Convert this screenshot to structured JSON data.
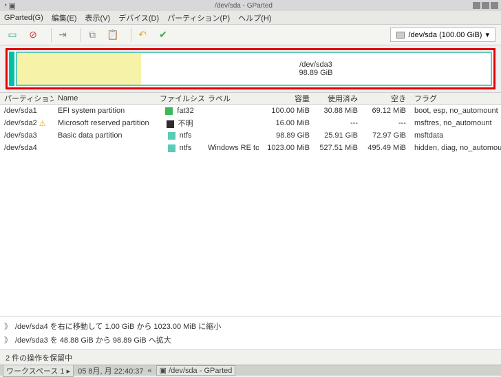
{
  "titlebar": {
    "title": "/dev/sda - GParted"
  },
  "menubar": {
    "gparted": "GParted(G)",
    "edit": "編集(E)",
    "view": "表示(V)",
    "device": "デバイス(D)",
    "partition": "パーティション(P)",
    "help": "ヘルプ(H)"
  },
  "toolbar": {
    "device_selector": "/dev/sda (100.00 GiB)"
  },
  "visual": {
    "selected_name": "/dev/sda3",
    "selected_size": "98.89 GiB"
  },
  "columns": {
    "partition": "パーティション",
    "name": "Name",
    "filesystem": "ファイルシステム",
    "label": "ラベル",
    "capacity": "容量",
    "used": "使用済み",
    "free": "空き",
    "flags": "フラグ"
  },
  "rows": [
    {
      "part": "/dev/sda1",
      "warn": false,
      "name": "EFI system partition",
      "fs": "fat32",
      "fscolor": "#3db85c",
      "label": "",
      "cap": "100.00 MiB",
      "used": "30.88 MiB",
      "free": "69.12 MiB",
      "flags": "boot, esp, no_automount"
    },
    {
      "part": "/dev/sda2",
      "warn": true,
      "name": "Microsoft reserved partition",
      "fs": "不明",
      "fscolor": "#2c2c2c",
      "label": "",
      "cap": "16.00 MiB",
      "used": "---",
      "free": "---",
      "flags": "msftres, no_automount"
    },
    {
      "part": "/dev/sda3",
      "warn": false,
      "name": "Basic data partition",
      "fs": "ntfs",
      "fscolor": "#59cdb7",
      "label": "",
      "cap": "98.89 GiB",
      "used": "25.91 GiB",
      "free": "72.97 GiB",
      "flags": "msftdata"
    },
    {
      "part": "/dev/sda4",
      "warn": false,
      "name": "",
      "fs": "ntfs",
      "fscolor": "#59cdb7",
      "label": "Windows RE tools",
      "cap": "1023.00 MiB",
      "used": "527.51 MiB",
      "free": "495.49 MiB",
      "flags": "hidden, diag, no_automount"
    }
  ],
  "ops": {
    "line1": "/dev/sda4 を右に移動して 1.00 GiB から 1023.00 MiB に縮小",
    "line2": "/dev/sda3 を 48.88 GiB から 98.89 GiB へ拡大"
  },
  "status": "2 件の操作を保留中",
  "taskbar": {
    "workspace": "ワークスペース 1",
    "clock": "05 8月, 月 22:40:37",
    "app": "/dev/sda - GParted"
  }
}
